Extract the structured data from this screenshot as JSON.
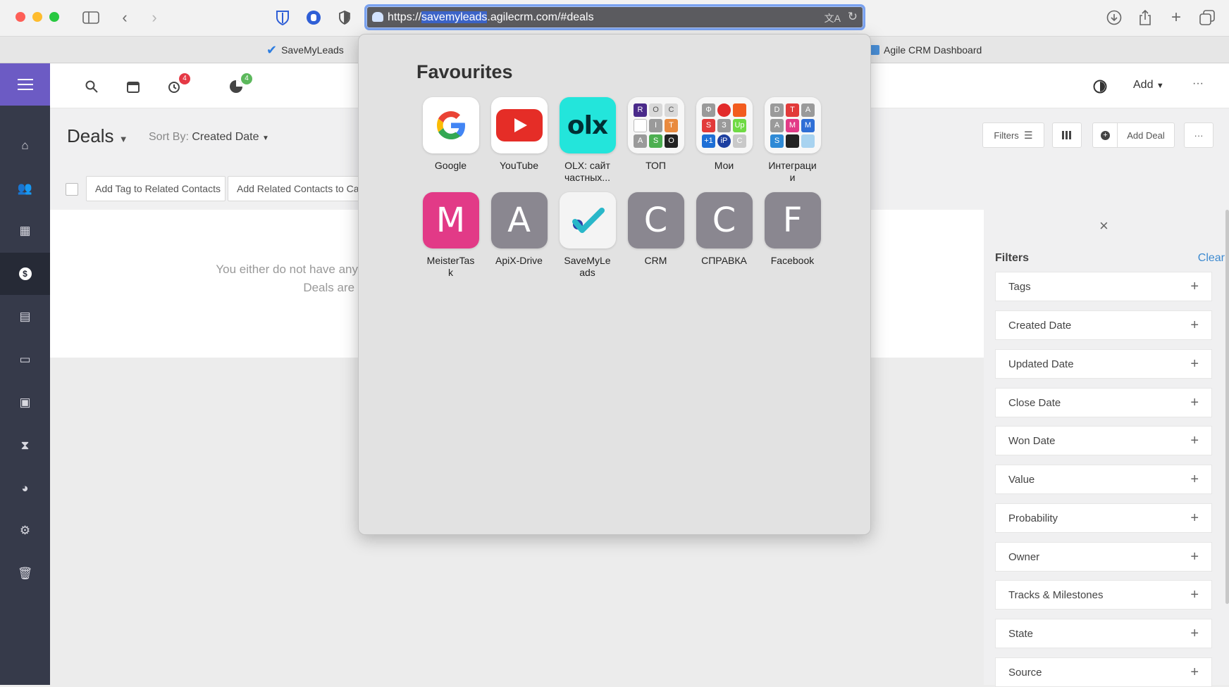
{
  "browser": {
    "url_prefix": "https://",
    "url_selected": "savemyleads",
    "url_suffix": ".agilecrm.com/#deals",
    "tabs": [
      {
        "label": "SaveMyLeads"
      },
      {
        "label": "Agile CRM Dashboard"
      }
    ]
  },
  "favourites": {
    "title": "Favourites",
    "items": [
      {
        "label": "Google",
        "icon": "google-icon"
      },
      {
        "label": "YouTube",
        "icon": "youtube-icon"
      },
      {
        "label": "OLX: сайт частных...",
        "icon": "olx-icon",
        "tile_text": "olx"
      },
      {
        "label": "ТОП",
        "icon": "folder-top-icon",
        "cells": [
          "R",
          "O",
          "C",
          "",
          "I",
          "T",
          "A",
          "S",
          "O"
        ]
      },
      {
        "label": "Мои",
        "icon": "folder-moi-icon",
        "cells": [
          "Ф",
          "",
          "",
          "S",
          "З",
          "Up",
          "+1",
          "iP",
          "C"
        ]
      },
      {
        "label": "Интеграции",
        "icon": "folder-integrations-icon",
        "cells": [
          "D",
          "T",
          "A",
          "A",
          "M",
          "M",
          "S",
          "",
          ""
        ]
      },
      {
        "label": "MeisterTask",
        "letter": "M",
        "color": "#e23a87"
      },
      {
        "label": "ApiX-Drive",
        "letter": "A",
        "color": "#8a8790"
      },
      {
        "label": "SaveMyLeads",
        "icon": "savemyleads-icon"
      },
      {
        "label": "CRM",
        "letter": "C",
        "color": "#8a8790"
      },
      {
        "label": "СПРАВКА",
        "letter": "C",
        "color": "#8a8790"
      },
      {
        "label": "Facebook",
        "letter": "F",
        "color": "#8a8790"
      }
    ]
  },
  "crm": {
    "header": {
      "alarm_badge": "4",
      "chart_badge": "4",
      "add_label": "Add",
      "more_label": "···"
    },
    "deals_title": "Deals",
    "sort_label": "Sort By:",
    "sort_value": "Created Date",
    "buttons": {
      "filters": "Filters",
      "add_deal": "Add Deal",
      "more": "···"
    },
    "actions": {
      "add_tag": "Add Tag to Related Contacts",
      "add_campaign": "Add Related Contacts to Campaign"
    },
    "empty_line1": "You either do not have any Deals or there are no matching results.",
    "empty_line2": "Deals are sorted by created date."
  },
  "filters": {
    "title": "Filters",
    "clear": "Clear",
    "items": [
      "Tags",
      "Created Date",
      "Updated Date",
      "Close Date",
      "Won Date",
      "Value",
      "Probability",
      "Owner",
      "Tracks & Milestones",
      "State",
      "Source"
    ]
  },
  "colors": {
    "accent": "#6c5bc4",
    "sidebar": "#363a4a",
    "link": "#3d8ad0"
  }
}
